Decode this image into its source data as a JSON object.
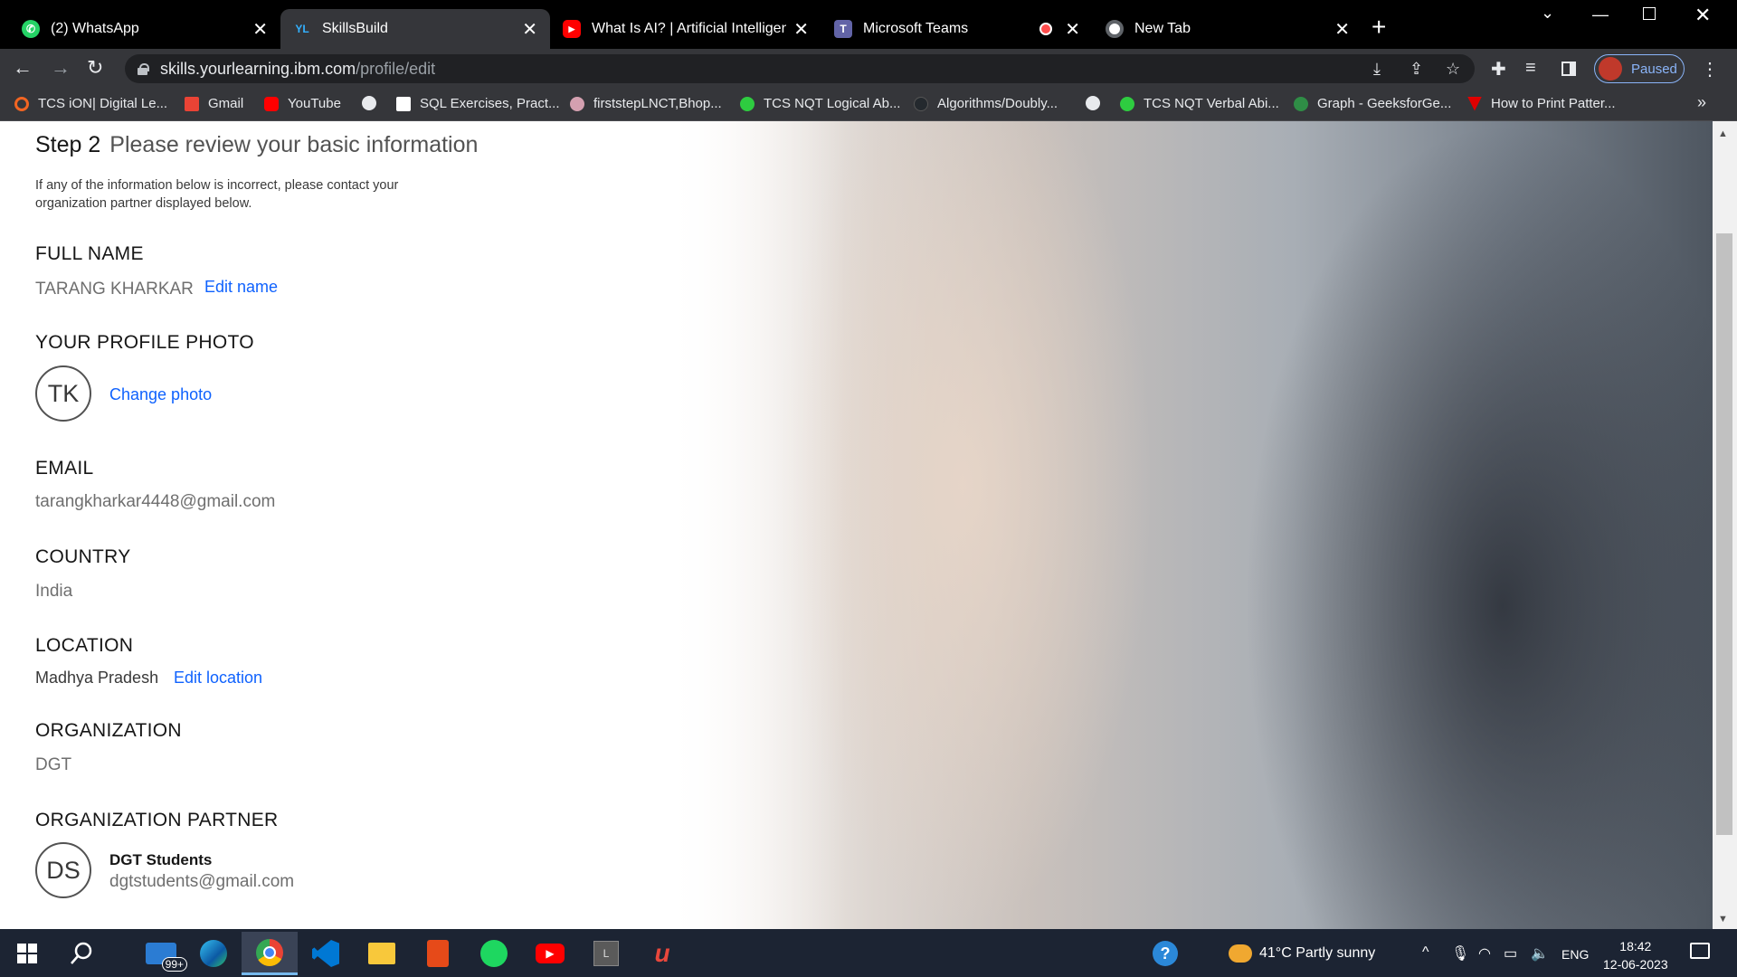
{
  "browser": {
    "tabs": [
      {
        "label": "(2) WhatsApp",
        "icon": "whatsapp-icon",
        "color": "#25d366"
      },
      {
        "label": "SkillsBuild",
        "icon": "skillsbuild-icon",
        "color": "#0f62fe"
      },
      {
        "label": "What Is AI? | Artificial Intelligence",
        "icon": "youtube-icon",
        "color": "#ff0000"
      },
      {
        "label": "Microsoft Teams",
        "icon": "teams-icon",
        "color": "#6264a7"
      },
      {
        "label": "New Tab",
        "icon": "chrome-icon",
        "color": "#ffffff"
      }
    ],
    "url_host": "skills.yourlearning.ibm.com",
    "url_path": "/profile/edit",
    "profile_status": "Paused",
    "bookmarks": [
      {
        "label": "TCS iON| Digital Le...",
        "icon": "tcs-ion-icon",
        "color": "#f26522"
      },
      {
        "label": "Gmail",
        "icon": "gmail-icon",
        "color": "#ea4335"
      },
      {
        "label": "YouTube",
        "icon": "youtube-icon",
        "color": "#ff0000"
      },
      {
        "label": "",
        "icon": "globe-icon",
        "color": "#e8eaed"
      },
      {
        "label": "SQL Exercises, Pract...",
        "icon": "w3r-icon",
        "color": "#ffffff"
      },
      {
        "label": "firststepLNCT,Bhop...",
        "icon": "lnct-icon",
        "color": "#d4a0b0"
      },
      {
        "label": "TCS NQT Logical Ab...",
        "icon": "tcs-nqt-icon",
        "color": "#2ecc40"
      },
      {
        "label": "Algorithms/Doubly...",
        "icon": "github-icon",
        "color": "#24292e"
      },
      {
        "label": "",
        "icon": "globe-icon",
        "color": "#e8eaed"
      },
      {
        "label": "TCS NQT Verbal Abi...",
        "icon": "tcs-nqt-icon",
        "color": "#2ecc40"
      },
      {
        "label": "Graph - GeeksforGe...",
        "icon": "geeksforgeeks-icon",
        "color": "#2f8d46"
      },
      {
        "label": "How to Print Patter...",
        "icon": "pattern-icon",
        "color": "#e00000"
      }
    ]
  },
  "page": {
    "step_number": "Step 2",
    "step_title": "Please review your basic information",
    "note": "If any of the information below is incorrect, please contact your organization partner displayed below.",
    "full_name_label": "FULL NAME",
    "full_name": "TARANG KHARKAR",
    "edit_name": "Edit name",
    "photo_label": "YOUR PROFILE PHOTO",
    "initials": "TK",
    "change_photo": "Change photo",
    "email_label": "EMAIL",
    "email": "tarangkharkar4448@gmail.com",
    "country_label": "COUNTRY",
    "country": "India",
    "location_label": "LOCATION",
    "location": "Madhya Pradesh",
    "edit_location": "Edit location",
    "organization_label": "ORGANIZATION",
    "organization": "DGT",
    "partner_label": "ORGANIZATION PARTNER",
    "partner_initials": "DS",
    "partner_name": "DGT Students",
    "partner_email": "dgtstudents@gmail.com"
  },
  "taskbar": {
    "mail_badge": "99+",
    "weather": "41°C  Partly sunny",
    "language": "ENG",
    "time": "18:42",
    "date": "12-06-2023"
  }
}
